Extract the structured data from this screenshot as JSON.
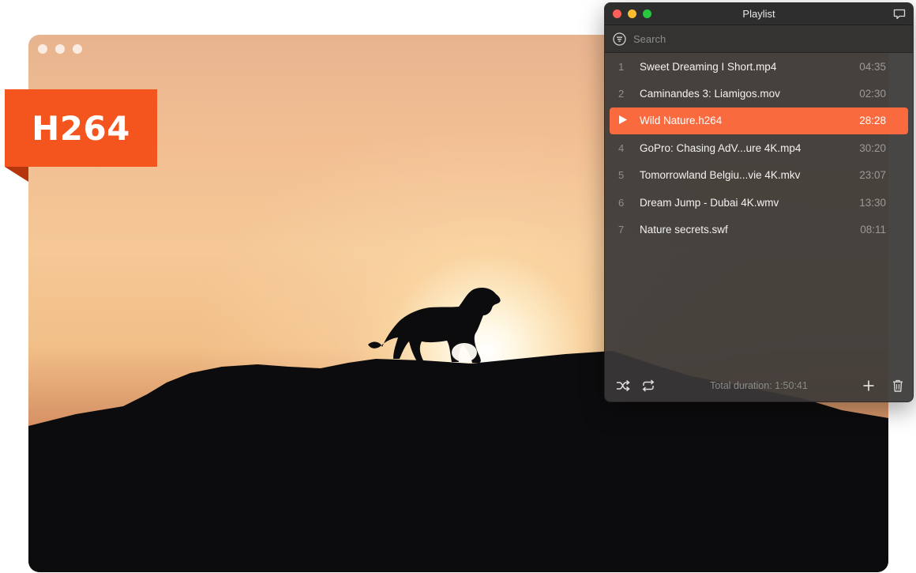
{
  "badge": {
    "text": "H264",
    "color": "#f4541e"
  },
  "playlist": {
    "title": "Playlist",
    "search_placeholder": "Search",
    "items": [
      {
        "num": "1",
        "name": "Sweet Dreaming I Short.mp4",
        "duration": "04:35"
      },
      {
        "num": "2",
        "name": "Caminandes 3: Liamigos.mov",
        "duration": "02:30"
      },
      {
        "num": "3",
        "name": "Wild Nature.h264",
        "duration": "28:28",
        "playing": true
      },
      {
        "num": "4",
        "name": "GoPro: Chasing AdV...ure 4K.mp4",
        "duration": "30:20"
      },
      {
        "num": "5",
        "name": "Tomorrowland Belgiu...vie 4K.mkv",
        "duration": "23:07"
      },
      {
        "num": "6",
        "name": "Dream Jump - Dubai 4K.wmv",
        "duration": "13:30"
      },
      {
        "num": "7",
        "name": "Nature secrets.swf",
        "duration": "08:11"
      }
    ],
    "total_duration": "Total duration: 1:50:41",
    "accent_color": "#fa6a3f"
  },
  "icons": {
    "shuffle": "shuffle-icon",
    "repeat": "repeat-icon",
    "add": "plus-icon",
    "delete": "trash-icon",
    "filter": "filter-icon",
    "chat": "chat-bubble-icon",
    "play": "play-icon"
  }
}
